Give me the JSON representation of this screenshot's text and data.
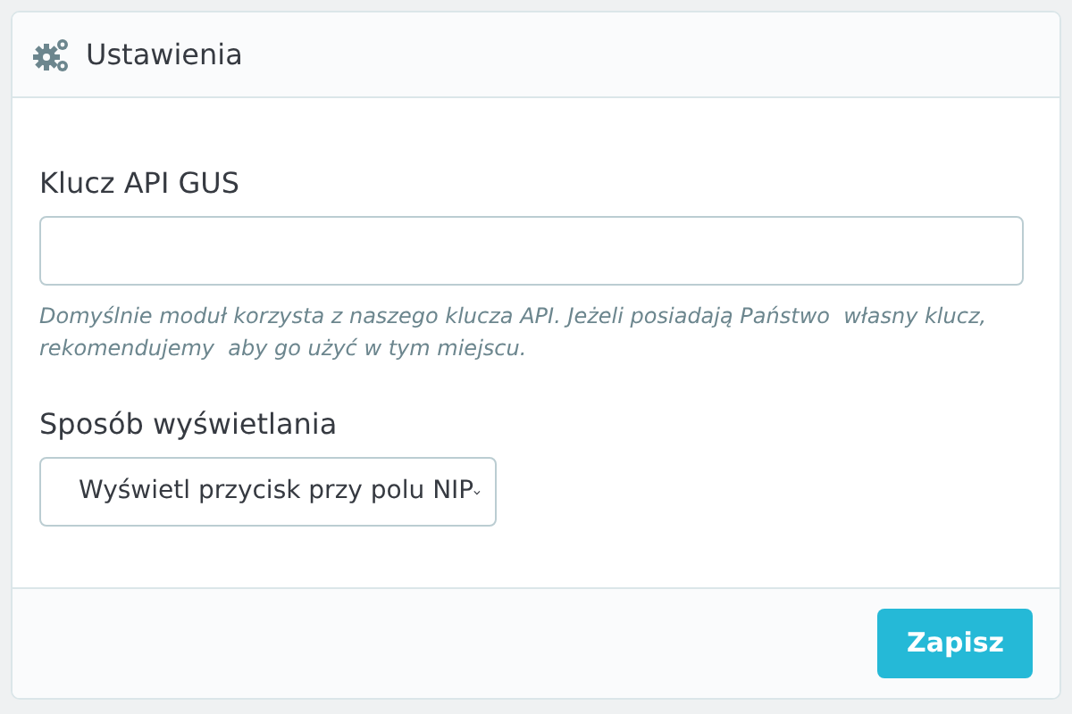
{
  "panel": {
    "title": "Ustawienia"
  },
  "fields": [
    {
      "kind": "text",
      "label": "Klucz API GUS",
      "help": "Domyślnie moduł korzysta z naszego klucza API. Jeżeli posiadają Państwo  własny klucz, rekomendujemy  aby go użyć w tym miejscu."
    },
    {
      "kind": "select",
      "label": "Sposób wyświetlania",
      "value": "Wyświetl przycisk przy polu NIP"
    }
  ],
  "buttons": [
    "Zapisz"
  ]
}
